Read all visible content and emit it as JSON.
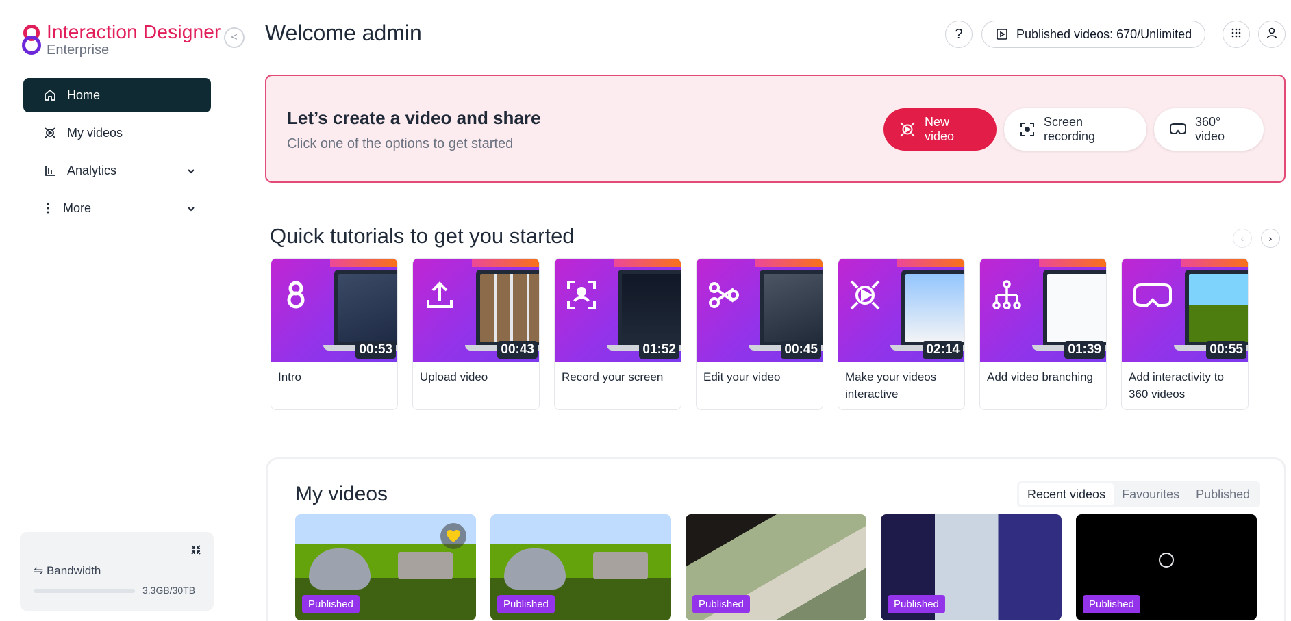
{
  "brand": {
    "title": "Interaction Designer",
    "subtitle": "Enterprise"
  },
  "sidebar": {
    "collapse_glyph": "<",
    "items": [
      {
        "label": "Home",
        "icon": "home-icon",
        "active": true
      },
      {
        "label": "My videos",
        "icon": "video-icon"
      },
      {
        "label": "Analytics",
        "icon": "bar-chart-icon"
      },
      {
        "label": "More",
        "icon": "more-vertical-icon"
      }
    ],
    "bandwidth": {
      "label": "⇋ Bandwidth",
      "value": "3.3GB/30TB",
      "fraction": 0.0001
    }
  },
  "header": {
    "welcome": "Welcome admin",
    "help": "?",
    "published": "Published videos: 670/Unlimited"
  },
  "banner": {
    "title": "Let’s create a video and share",
    "subtitle": "Click one of the options to get started",
    "new_video": "New video",
    "screen_recording": "Screen recording",
    "video_360": "360° video",
    "colors": {
      "accent": "#e11d48",
      "background": "#fdecef"
    }
  },
  "tutorials": {
    "title": "Quick tutorials to get you started",
    "prev": "‹",
    "next": "›",
    "items": [
      {
        "label": "Intro",
        "duration": "00:53"
      },
      {
        "label": "Upload video",
        "duration": "00:43"
      },
      {
        "label": "Record your screen",
        "duration": "01:52"
      },
      {
        "label": "Edit your video",
        "duration": "00:45"
      },
      {
        "label": "Make your videos interactive",
        "duration": "02:14"
      },
      {
        "label": "Add video branching",
        "duration": "01:39"
      },
      {
        "label": "Add interactivity to 360 videos",
        "duration": "00:55"
      }
    ]
  },
  "my_videos": {
    "title": "My videos",
    "tabs": [
      "Recent videos",
      "Favourites",
      "Published"
    ],
    "active_tab": "Recent videos",
    "videos": [
      {
        "status": "Published",
        "favourite": true
      },
      {
        "status": "Published"
      },
      {
        "status": "Published"
      },
      {
        "status": "Published"
      },
      {
        "status": "Published"
      }
    ]
  }
}
